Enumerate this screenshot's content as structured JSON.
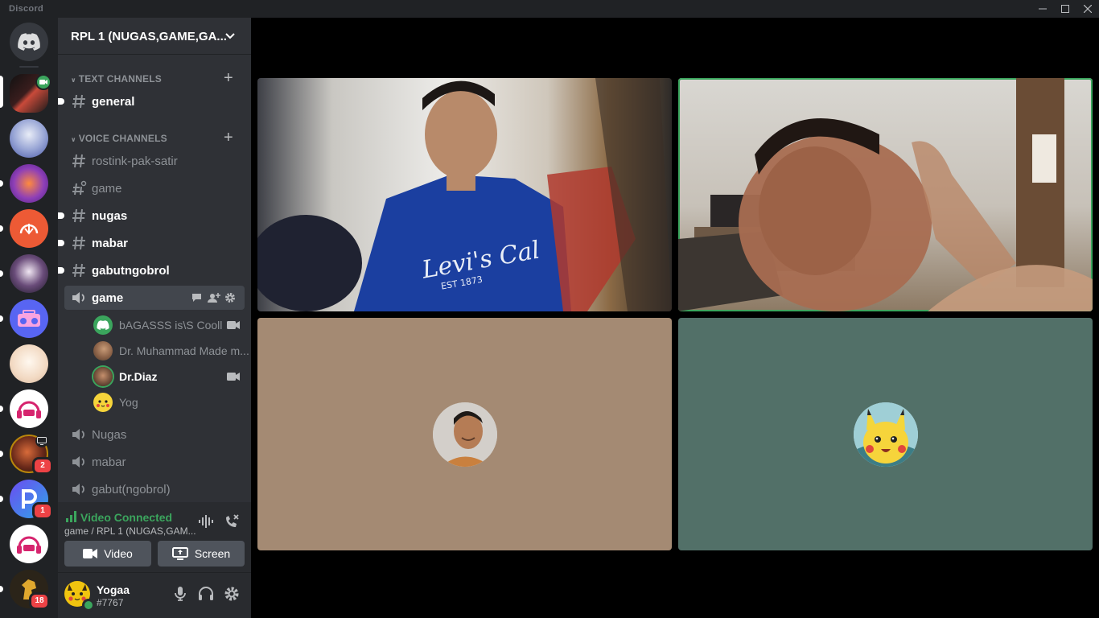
{
  "app": {
    "title": "Discord"
  },
  "server": {
    "name": "RPL 1 (NUGAS,GAME,GA..."
  },
  "categories": {
    "text": "TEXT CHANNELS",
    "voice": "VOICE CHANNELS"
  },
  "channels": [
    {
      "name": "general",
      "kind": "text",
      "unread": true
    },
    {
      "name": "rostink-pak-satir",
      "kind": "text",
      "unread": false
    },
    {
      "name": "game",
      "kind": "text-thread",
      "unread": false
    },
    {
      "name": "nugas",
      "kind": "text",
      "unread": true
    },
    {
      "name": "mabar",
      "kind": "text",
      "unread": true
    },
    {
      "name": "gabutngobrol",
      "kind": "text",
      "unread": true
    },
    {
      "name": "game",
      "kind": "voice",
      "active": true
    },
    {
      "name": "Nugas",
      "kind": "voice"
    },
    {
      "name": "mabar",
      "kind": "voice"
    },
    {
      "name": "gabut(ngobrol)",
      "kind": "voice"
    }
  ],
  "voice_users": [
    {
      "name": "bAGASSS is\\S Cooll",
      "video": true,
      "speaking": false
    },
    {
      "name": "Dr. Muhammad Made m...",
      "video": false,
      "speaking": false
    },
    {
      "name": "Dr.Diaz",
      "video": true,
      "speaking": true
    },
    {
      "name": "Yog",
      "video": false,
      "speaking": false
    }
  ],
  "voice_panel": {
    "status": "Video Connected",
    "location": "game / RPL 1 (NUGAS,GAM...",
    "video_label": "Video",
    "screen_label": "Screen"
  },
  "user": {
    "name": "Yogaa",
    "tag": "#7767"
  },
  "rail_badges": {
    "b1": "2",
    "b2": "1",
    "b3": "18"
  },
  "shirt_text": {
    "brand": "Levi's Cal",
    "est": "EST 1873"
  },
  "colors": {
    "rail_bg": "#202225",
    "sidebar_bg": "#2f3136",
    "panel_bg": "#292b2f",
    "green": "#3ba55d",
    "blurple": "#5865f2",
    "tile_tan": "#a48a73",
    "tile_teal": "#527068"
  }
}
